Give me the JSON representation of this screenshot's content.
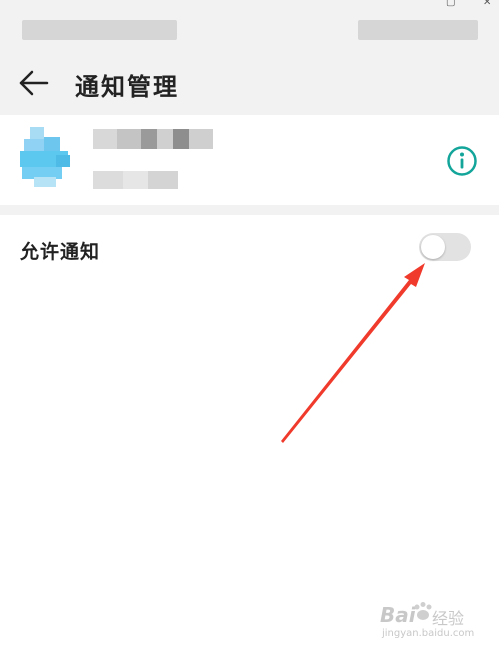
{
  "header": {
    "title": "通知管理",
    "back_icon": "arrow-left-icon"
  },
  "app": {
    "name": "",
    "info_icon": "info-circle-icon",
    "icon_color": "#5cc8f0"
  },
  "settings": {
    "allow_notifications": {
      "label": "允许通知",
      "enabled": false
    }
  },
  "annotation": {
    "arrow_color": "#f03a2c"
  },
  "watermark": {
    "brand": "Bai",
    "sub": "经验",
    "url": "jingyan.baidu.com"
  },
  "colors": {
    "accent": "#13a59a",
    "header_bg": "#f2f2f2",
    "toggle_off": "#e2e2e2"
  }
}
